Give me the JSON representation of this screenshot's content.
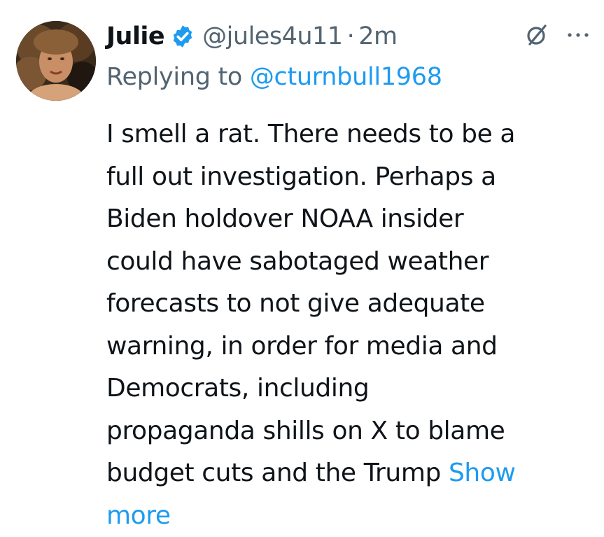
{
  "tweet": {
    "author_name": "Julie",
    "handle": "@jules4u11",
    "separator": "·",
    "time": "2m",
    "replying_prefix": "Replying to",
    "replying_to": "@cturnbull1968",
    "body_lines": [
      "I smell a rat. There needs to be a",
      "full out investigation. Perhaps a",
      "Biden holdover NOAA insider",
      "could have sabotaged weather",
      "forecasts to not give adequate",
      "warning, in order for media and",
      "Democrats, including",
      "propaganda shills on X to blame",
      "budget cuts and the Trump"
    ],
    "show_more_part1": "Show",
    "show_more_part2": "more"
  },
  "icons": {
    "verified": "verified-badge-icon",
    "grok": "grok-icon",
    "more": "more-options-icon"
  },
  "colors": {
    "text": "#0f1419",
    "secondary": "#536471",
    "accent": "#1d9bf0",
    "background": "#ffffff"
  }
}
